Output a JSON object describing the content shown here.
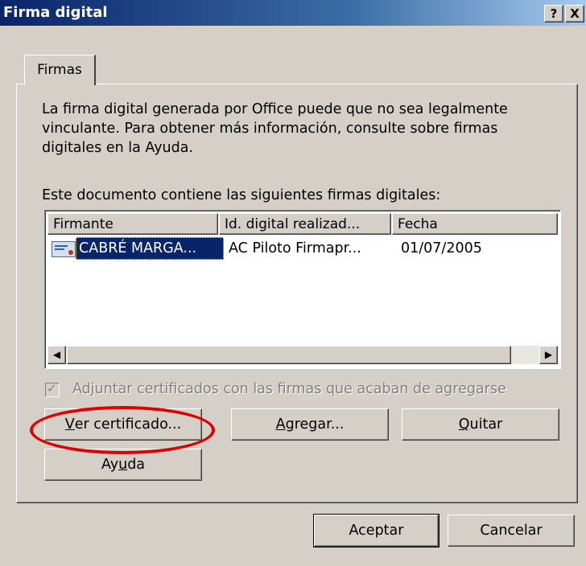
{
  "window": {
    "title": "Firma digital",
    "help_button": "?",
    "close_button": "X"
  },
  "tabs": [
    {
      "label": "Firmas"
    }
  ],
  "description": "La firma digital generada por Office puede que no sea legalmente vinculante. Para obtener más información, consulte sobre firmas digitales en la Ayuda.",
  "list_label": "Este documento contiene las siguientes firmas digitales:",
  "table": {
    "columns": [
      "Firmante",
      "Id. digital realizad...",
      "Fecha"
    ],
    "rows": [
      {
        "firmante": "CABRÉ MARGA...",
        "id_digital": "AC Piloto Firmapr...",
        "fecha": "01/07/2005",
        "icon": "certificate-icon",
        "selected": true
      }
    ]
  },
  "checkbox": {
    "label": "Adjuntar certificados con las firmas que acaban de agregarse",
    "checked": true,
    "enabled": false
  },
  "buttons": {
    "ver_certificado": {
      "pre": "",
      "accel": "V",
      "post": "er certificado..."
    },
    "agregar": {
      "pre": "",
      "accel": "A",
      "post": "gregar..."
    },
    "quitar": {
      "pre": "",
      "accel": "Q",
      "post": "uitar"
    },
    "ayuda": {
      "pre": "Ay",
      "accel": "u",
      "post": "da"
    },
    "aceptar": "Aceptar",
    "cancelar": "Cancelar"
  },
  "colors": {
    "dialog_bg": "#d4d0c8",
    "titlebar_start": "#0a246a",
    "selection": "#0a246a",
    "highlight_oval": "#e00000"
  }
}
